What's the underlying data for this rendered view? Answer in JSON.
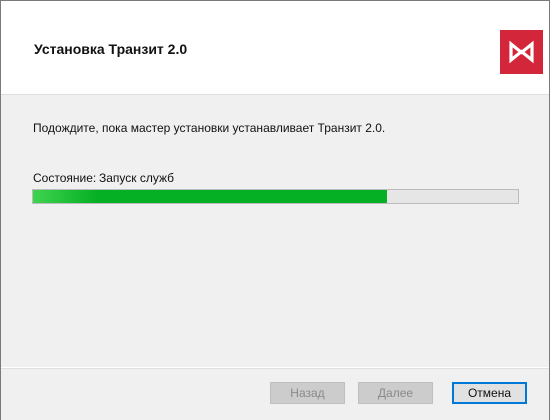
{
  "window": {
    "title": "Установка Транзит 2.0"
  },
  "logo": {
    "icon": "msk-exchange-logo-icon",
    "color": "#d3263a"
  },
  "content": {
    "message": "Подождите, пока мастер установки устанавливает Транзит 2.0.",
    "status_label": "Состояние:",
    "status_value": "Запуск служб",
    "progress_fraction": 0.73,
    "progress_color": "#06b025"
  },
  "footer": {
    "back_label": "Назад",
    "next_label": "Далее",
    "cancel_label": "Отмена",
    "focus_color": "#0078d7"
  }
}
